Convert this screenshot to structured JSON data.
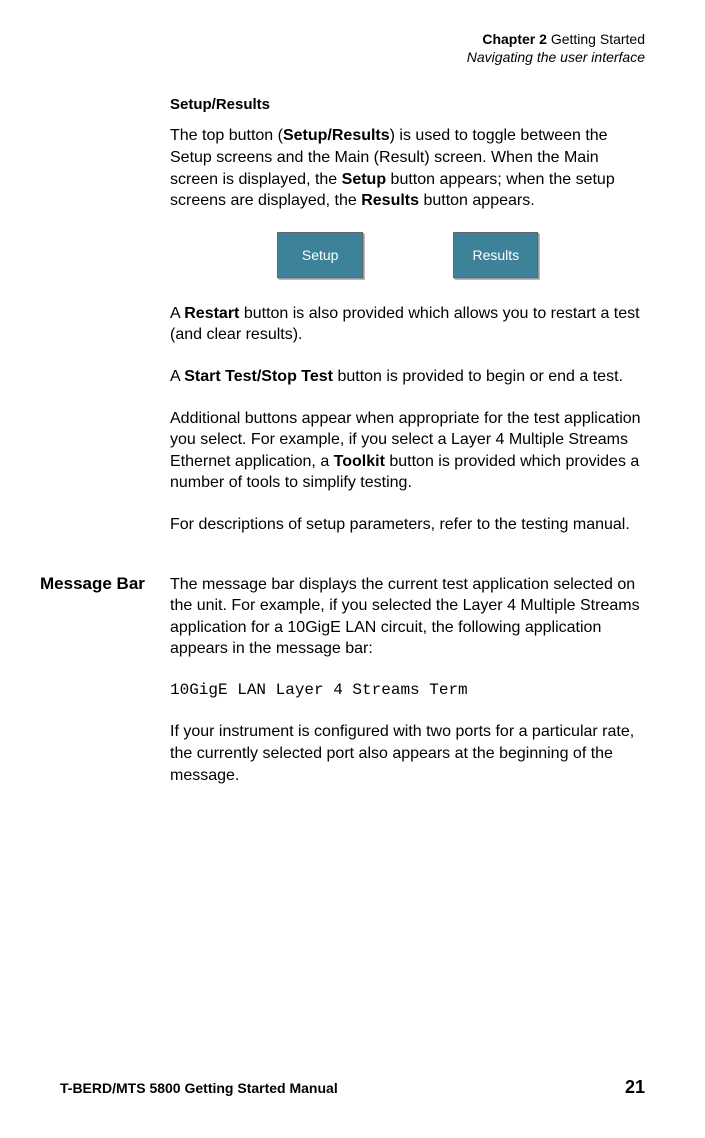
{
  "header": {
    "chapter_label": "Chapter 2",
    "chapter_title": "Getting Started",
    "subtitle": "Navigating the user interface"
  },
  "section1": {
    "heading": "Setup/Results",
    "para1_pre": "The top button (",
    "para1_bold1": "Setup/Results",
    "para1_mid1": ") is used to toggle between the Setup screens and the Main (Result) screen. When the Main screen is displayed, the ",
    "para1_bold2": "Setup",
    "para1_mid2": " button appears; when the setup screens are displayed, the ",
    "para1_bold3": "Results",
    "para1_end": " button appears."
  },
  "buttons": {
    "setup": "Setup",
    "results": "Results"
  },
  "section1b": {
    "restart_pre": "A ",
    "restart_bold": "Restart",
    "restart_end": " button is also provided which allows you to restart a test (and clear results).",
    "start_pre": "A ",
    "start_bold": "Start Test/Stop Test",
    "start_end": " button is provided to begin or end a test.",
    "toolkit_pre": "Additional buttons appear when appropriate for the test application you select. For example, if you select a Layer 4 Multiple Streams Ethernet application, a ",
    "toolkit_bold": "Toolkit",
    "toolkit_end": " button is provided which provides a number of tools to simplify testing.",
    "desc": "For descriptions of setup parameters, refer to the testing manual."
  },
  "section2": {
    "label": "Message Bar",
    "para1": "The message bar displays the current test application selected on the unit. For example, if you selected the Layer 4 Multiple Streams application for a 10GigE LAN circuit, the following application appears in the message bar:",
    "mono": "10GigE LAN Layer 4 Streams Term",
    "para2": "If your instrument is configured with two ports for a particular rate, the currently selected port also appears at the beginning of the message."
  },
  "footer": {
    "manual": "T-BERD/MTS 5800 Getting Started Manual",
    "page": "21"
  }
}
